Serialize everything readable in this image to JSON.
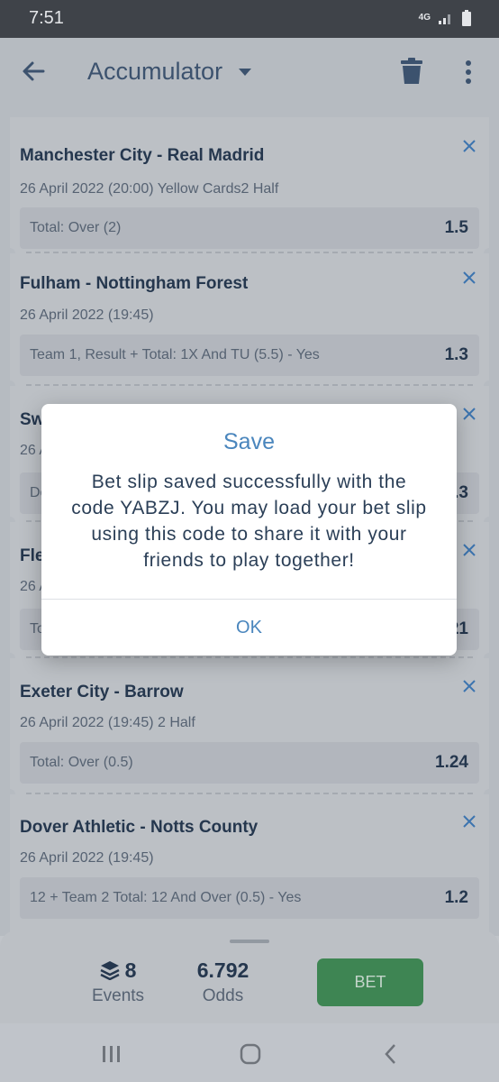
{
  "status_bar": {
    "time": "7:51",
    "network": "4G"
  },
  "app_bar": {
    "title": "Accumulator",
    "icons": [
      "back-arrow-icon",
      "chevron-down-icon",
      "trash-icon",
      "more-vert-icon"
    ]
  },
  "bets": [
    {
      "match": "Manchester City - Real Madrid",
      "meta": "26 April 2022 (20:00) Yellow Cards2 Half",
      "bet": "Total: Over (2)",
      "odds": "1.5"
    },
    {
      "match": "Fulham - Nottingham Forest",
      "meta": "26 April 2022 (19:45)",
      "bet": "Team 1, Result + Total: 1X And TU (5.5) - Yes",
      "odds": "1.3"
    },
    {
      "match": "Sw",
      "meta": "26 A",
      "bet": "Do",
      "odds": ".3"
    },
    {
      "match": "Fle",
      "meta": "26 A",
      "bet": "To",
      "odds": "21"
    },
    {
      "match": "Exeter City - Barrow",
      "meta": "26 April 2022 (19:45) 2 Half",
      "bet": "Total: Over (0.5)",
      "odds": "1.24"
    },
    {
      "match": "Dover Athletic - Notts County",
      "meta": "26 April 2022 (19:45)",
      "bet": "12 + Team 2 Total: 12 And Over (0.5) - Yes",
      "odds": "1.2"
    }
  ],
  "summary": {
    "events_count": "8",
    "events_label": "Events",
    "odds_value": "6.792",
    "odds_label": "Odds",
    "bet_button": "BET"
  },
  "dialog": {
    "title": "Save",
    "message": "Bet slip saved successfully with the code YABZJ. You may load your bet slip using this code to share it with your friends to play together!",
    "ok_button": "OK"
  },
  "colors": {
    "accent": "#4a86bd",
    "bet_button": "#3f8f55",
    "text_dark": "#23364f"
  }
}
